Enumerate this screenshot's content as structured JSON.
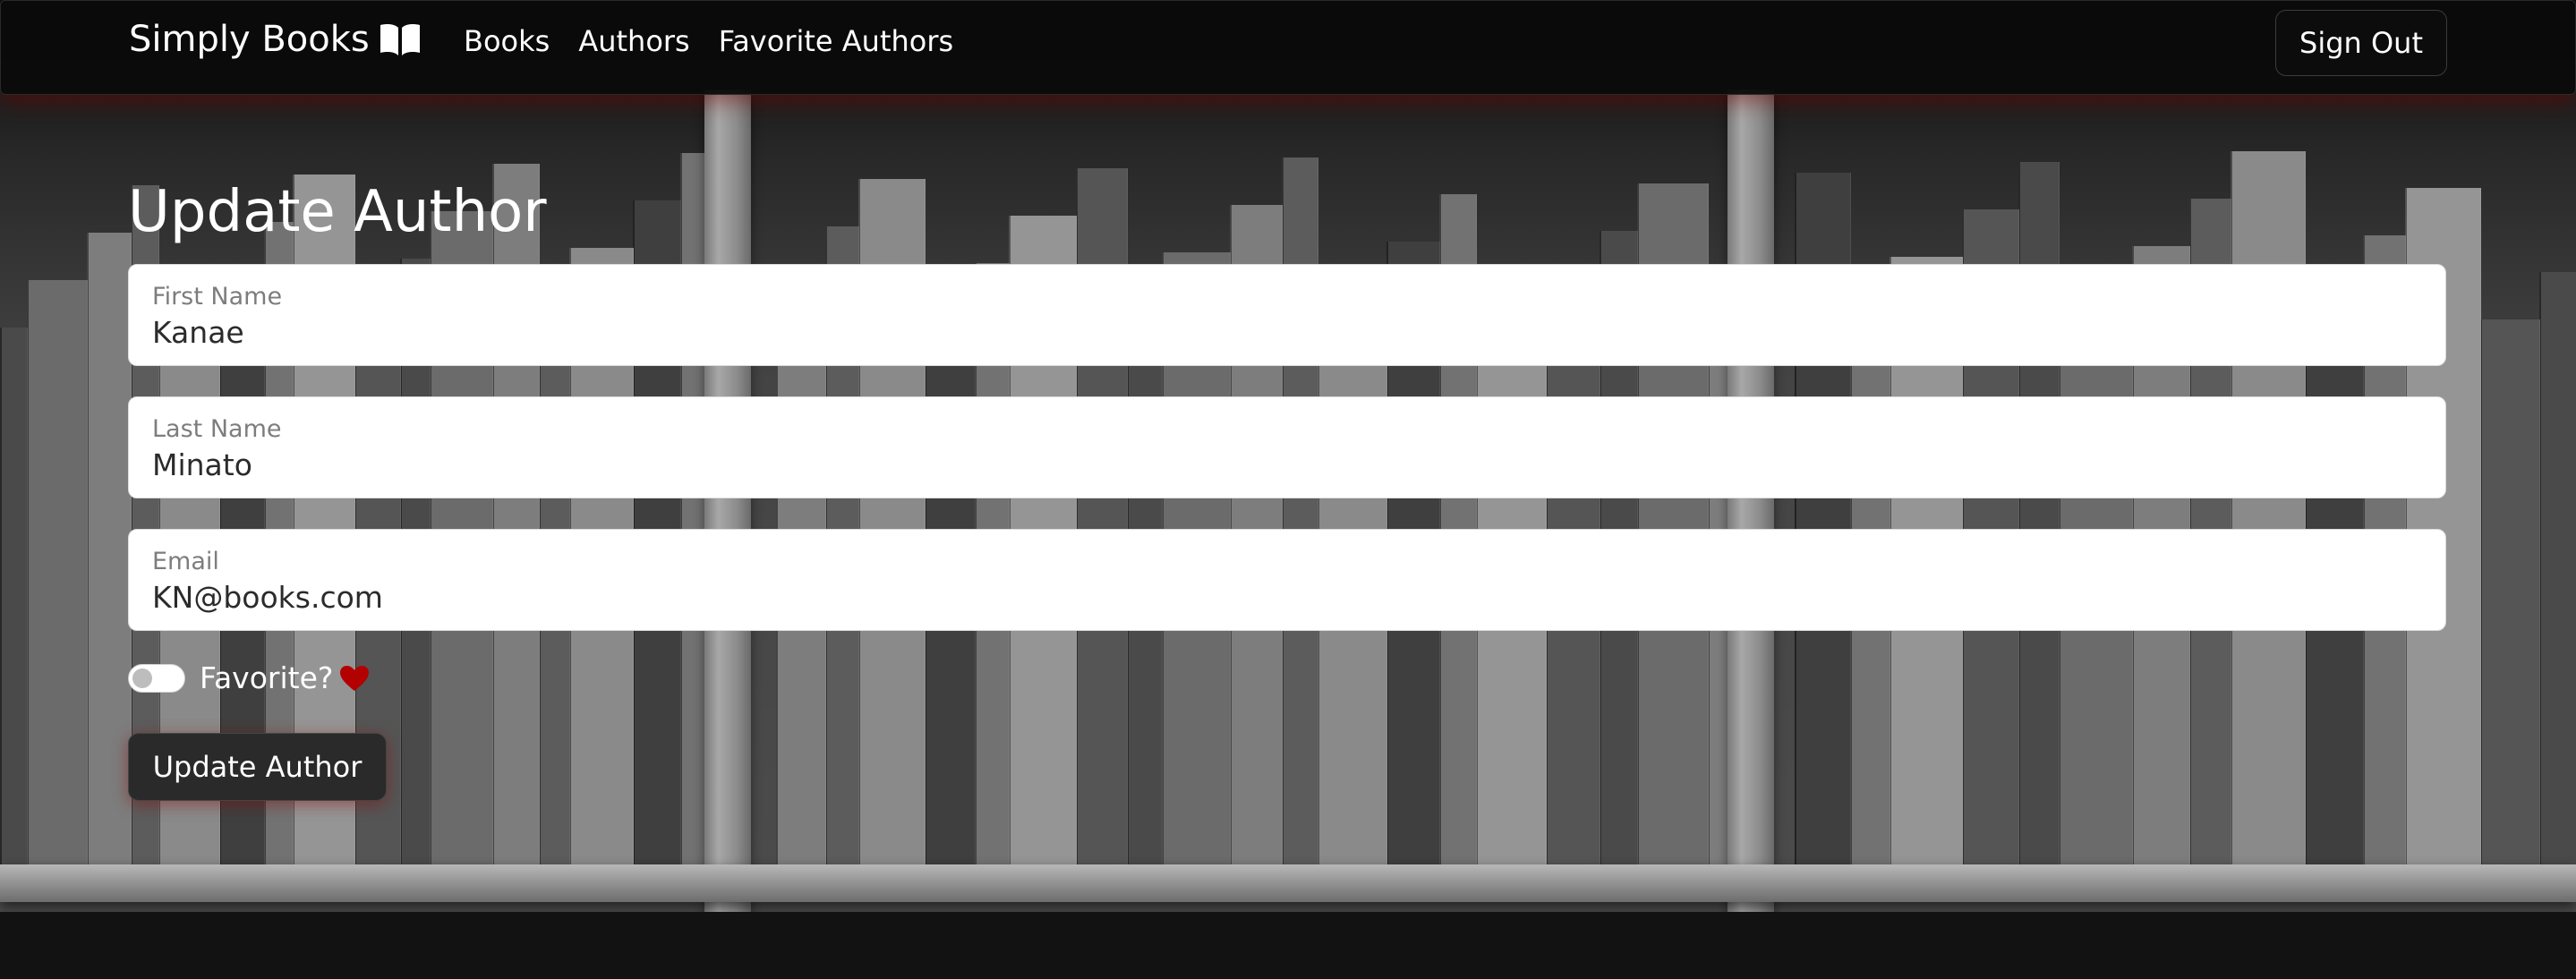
{
  "nav": {
    "brand": "Simply Books",
    "brand_icon": "open-book-icon",
    "links": [
      "Books",
      "Authors",
      "Favorite Authors"
    ],
    "sign_out_label": "Sign Out"
  },
  "page": {
    "title": "Update Author"
  },
  "form": {
    "first_name": {
      "label": "First Name",
      "value": "Kanae"
    },
    "last_name": {
      "label": "Last Name",
      "value": "Minato"
    },
    "email": {
      "label": "Email",
      "value": "KN@books.com"
    },
    "favorite": {
      "label": "Favorite?",
      "checked": false,
      "icon": "heart-icon"
    },
    "submit_label": "Update Author"
  },
  "colors": {
    "navbar_bg": "#0a0a0a",
    "accent_red": "#b30000",
    "button_bg": "#2a2a2a",
    "text_white": "#ffffff"
  }
}
